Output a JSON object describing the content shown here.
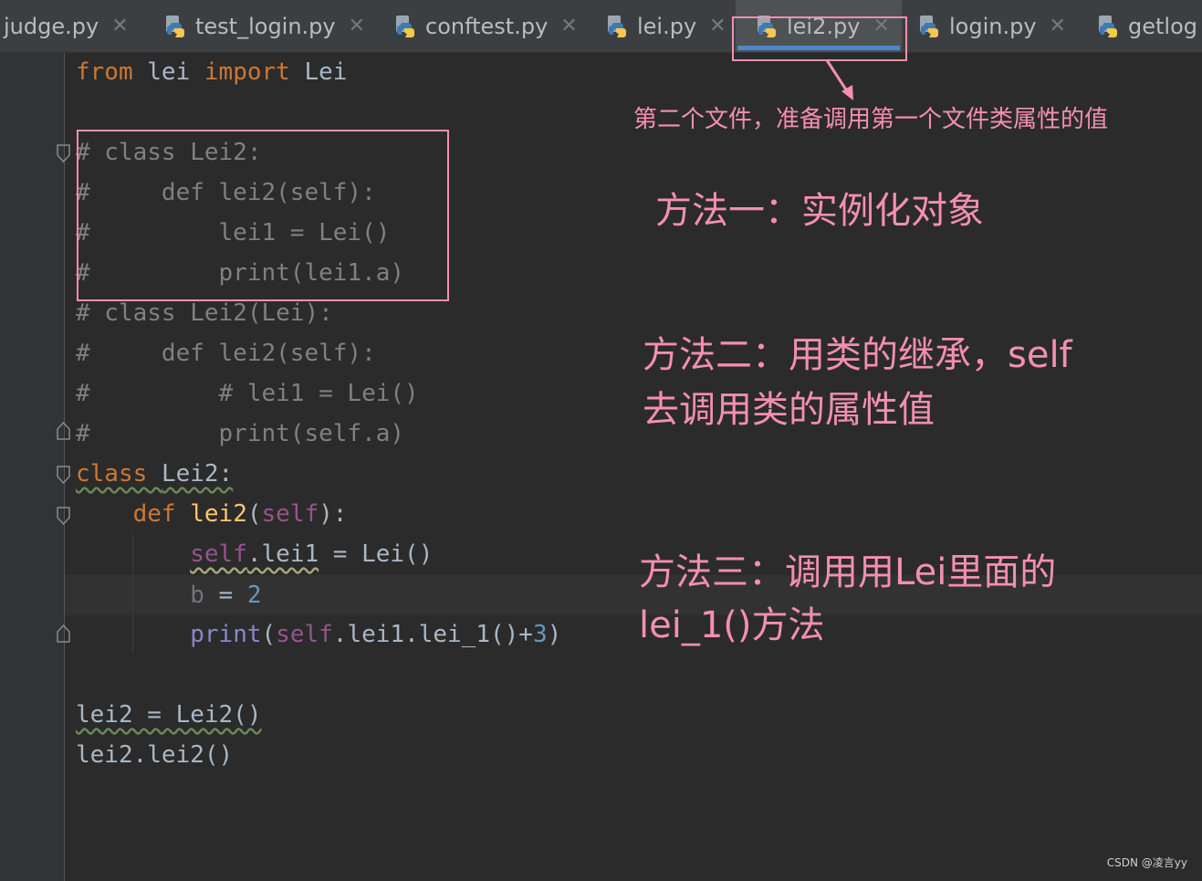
{
  "tabs": [
    {
      "label": "judge.py",
      "active": false
    },
    {
      "label": "test_login.py",
      "active": false
    },
    {
      "label": "conftest.py",
      "active": false
    },
    {
      "label": "lei.py",
      "active": false
    },
    {
      "label": "lei2.py",
      "active": true
    },
    {
      "label": "login.py",
      "active": false
    },
    {
      "label": "getlog",
      "active": false
    }
  ],
  "code": {
    "line1": {
      "kw_from": "from",
      "mod": " lei ",
      "kw_import": "import",
      "name": " Lei"
    },
    "line3": "# class Lei2:",
    "line4": "#     def lei2(self):",
    "line5": "#         lei1 = Lei()",
    "line6": "#         print(lei1.a)",
    "line7": "# class Lei2(Lei):",
    "line8": "#     def lei2(self):",
    "line9": "#         # lei1 = Lei()",
    "line10": "#         print(self.a)",
    "line11": {
      "kw": "class",
      "name": "Lei2:"
    },
    "line12": {
      "indent": "    ",
      "kw": "def",
      "fn": "lei2",
      "open": "(",
      "self": "self",
      "close": "):"
    },
    "line13": {
      "indent": "        ",
      "self": "self",
      "attr": ".lei1",
      "rest": " = Lei()"
    },
    "line14": {
      "indent": "        ",
      "var": "b",
      "op": " = ",
      "num": "2"
    },
    "line15": {
      "indent": "        ",
      "print": "print",
      "open": "(",
      "self": "self",
      "rest": ".lei1.lei_1()+",
      "num": "3",
      "close": ")"
    },
    "line17": "lei2 = Lei2()",
    "line18": "lei2.lei2()"
  },
  "annotations": {
    "tab_note": "第二个文件，准备调用第一个文件类属性的值",
    "method1": "方法一：实例化对象",
    "method2_line1": "方法二：用类的继承，self",
    "method2_line2": "去调用类的属性值",
    "method3_line1": "方法三：调用用Lei里面的",
    "method3_line2": "lei_1()方法"
  },
  "watermark": "CSDN @凌言yy",
  "colors": {
    "background": "#2b2b2b",
    "annotation": "#f48fb1",
    "keyword": "#cc7832",
    "comment": "#808080"
  }
}
